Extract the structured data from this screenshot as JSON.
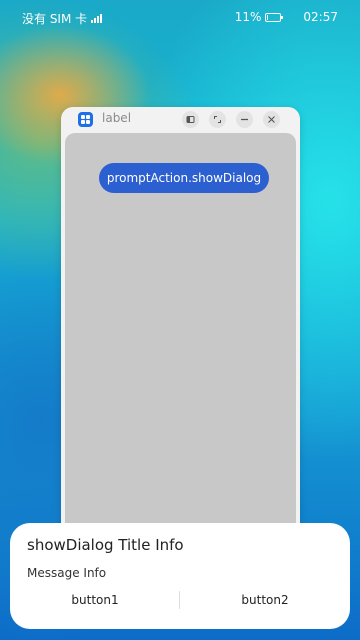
{
  "status_bar": {
    "carrier": "没有 SIM 卡",
    "battery_text": "11%",
    "battery_level": 0.11,
    "time": "02:57"
  },
  "window": {
    "title": "label",
    "app_icon": "app-grid-icon",
    "controls": [
      "split-screen-icon",
      "maximize-icon",
      "minimize-icon",
      "close-icon"
    ],
    "button_label": "promptAction.showDialog",
    "accent": "#2c5fd0"
  },
  "dialog": {
    "title": "showDialog Title Info",
    "message": "Message Info",
    "buttons": [
      "button1",
      "button2"
    ]
  }
}
